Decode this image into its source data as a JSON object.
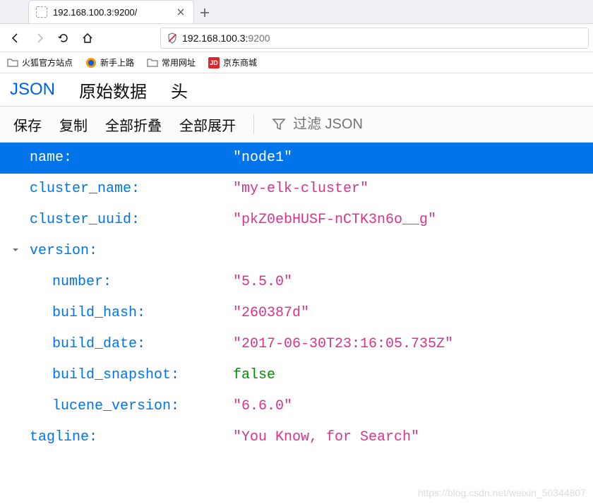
{
  "tab": {
    "title": "192.168.100.3:9200/"
  },
  "url": {
    "host": "192.168.100.3:",
    "port": "9200"
  },
  "bookmarks": [
    {
      "label": "火狐官方站点",
      "icon": "folder"
    },
    {
      "label": "新手上路",
      "icon": "firefox"
    },
    {
      "label": "常用网址",
      "icon": "folder"
    },
    {
      "label": "京东商城",
      "icon": "jd"
    }
  ],
  "viewer_tabs": {
    "json": "JSON",
    "raw": "原始数据",
    "headers": "头"
  },
  "toolbar": {
    "save": "保存",
    "copy": "复制",
    "collapse_all": "全部折叠",
    "expand_all": "全部展开",
    "filter_placeholder": "过滤 JSON"
  },
  "json_data": {
    "rows": [
      {
        "key": "name:",
        "value": "\"node1\"",
        "type": "string",
        "selected": true,
        "nested": false
      },
      {
        "key": "cluster_name:",
        "value": "\"my-elk-cluster\"",
        "type": "string",
        "selected": false,
        "nested": false
      },
      {
        "key": "cluster_uuid:",
        "value": "\"pkZ0ebHUSF-nCTK3n6o__g\"",
        "type": "string",
        "selected": false,
        "nested": false
      },
      {
        "key": "version:",
        "value": "",
        "type": "object",
        "selected": false,
        "nested": false,
        "expandable": true
      },
      {
        "key": "number:",
        "value": "\"5.5.0\"",
        "type": "string",
        "selected": false,
        "nested": true
      },
      {
        "key": "build_hash:",
        "value": "\"260387d\"",
        "type": "string",
        "selected": false,
        "nested": true
      },
      {
        "key": "build_date:",
        "value": "\"2017-06-30T23:16:05.735Z\"",
        "type": "string",
        "selected": false,
        "nested": true
      },
      {
        "key": "build_snapshot:",
        "value": "false",
        "type": "bool",
        "selected": false,
        "nested": true
      },
      {
        "key": "lucene_version:",
        "value": "\"6.6.0\"",
        "type": "string",
        "selected": false,
        "nested": true
      },
      {
        "key": "tagline:",
        "value": "\"You Know, for Search\"",
        "type": "string",
        "selected": false,
        "nested": false
      }
    ]
  },
  "watermark": "https://blog.csdn.net/weixin_50344807",
  "jd_text": "JD"
}
